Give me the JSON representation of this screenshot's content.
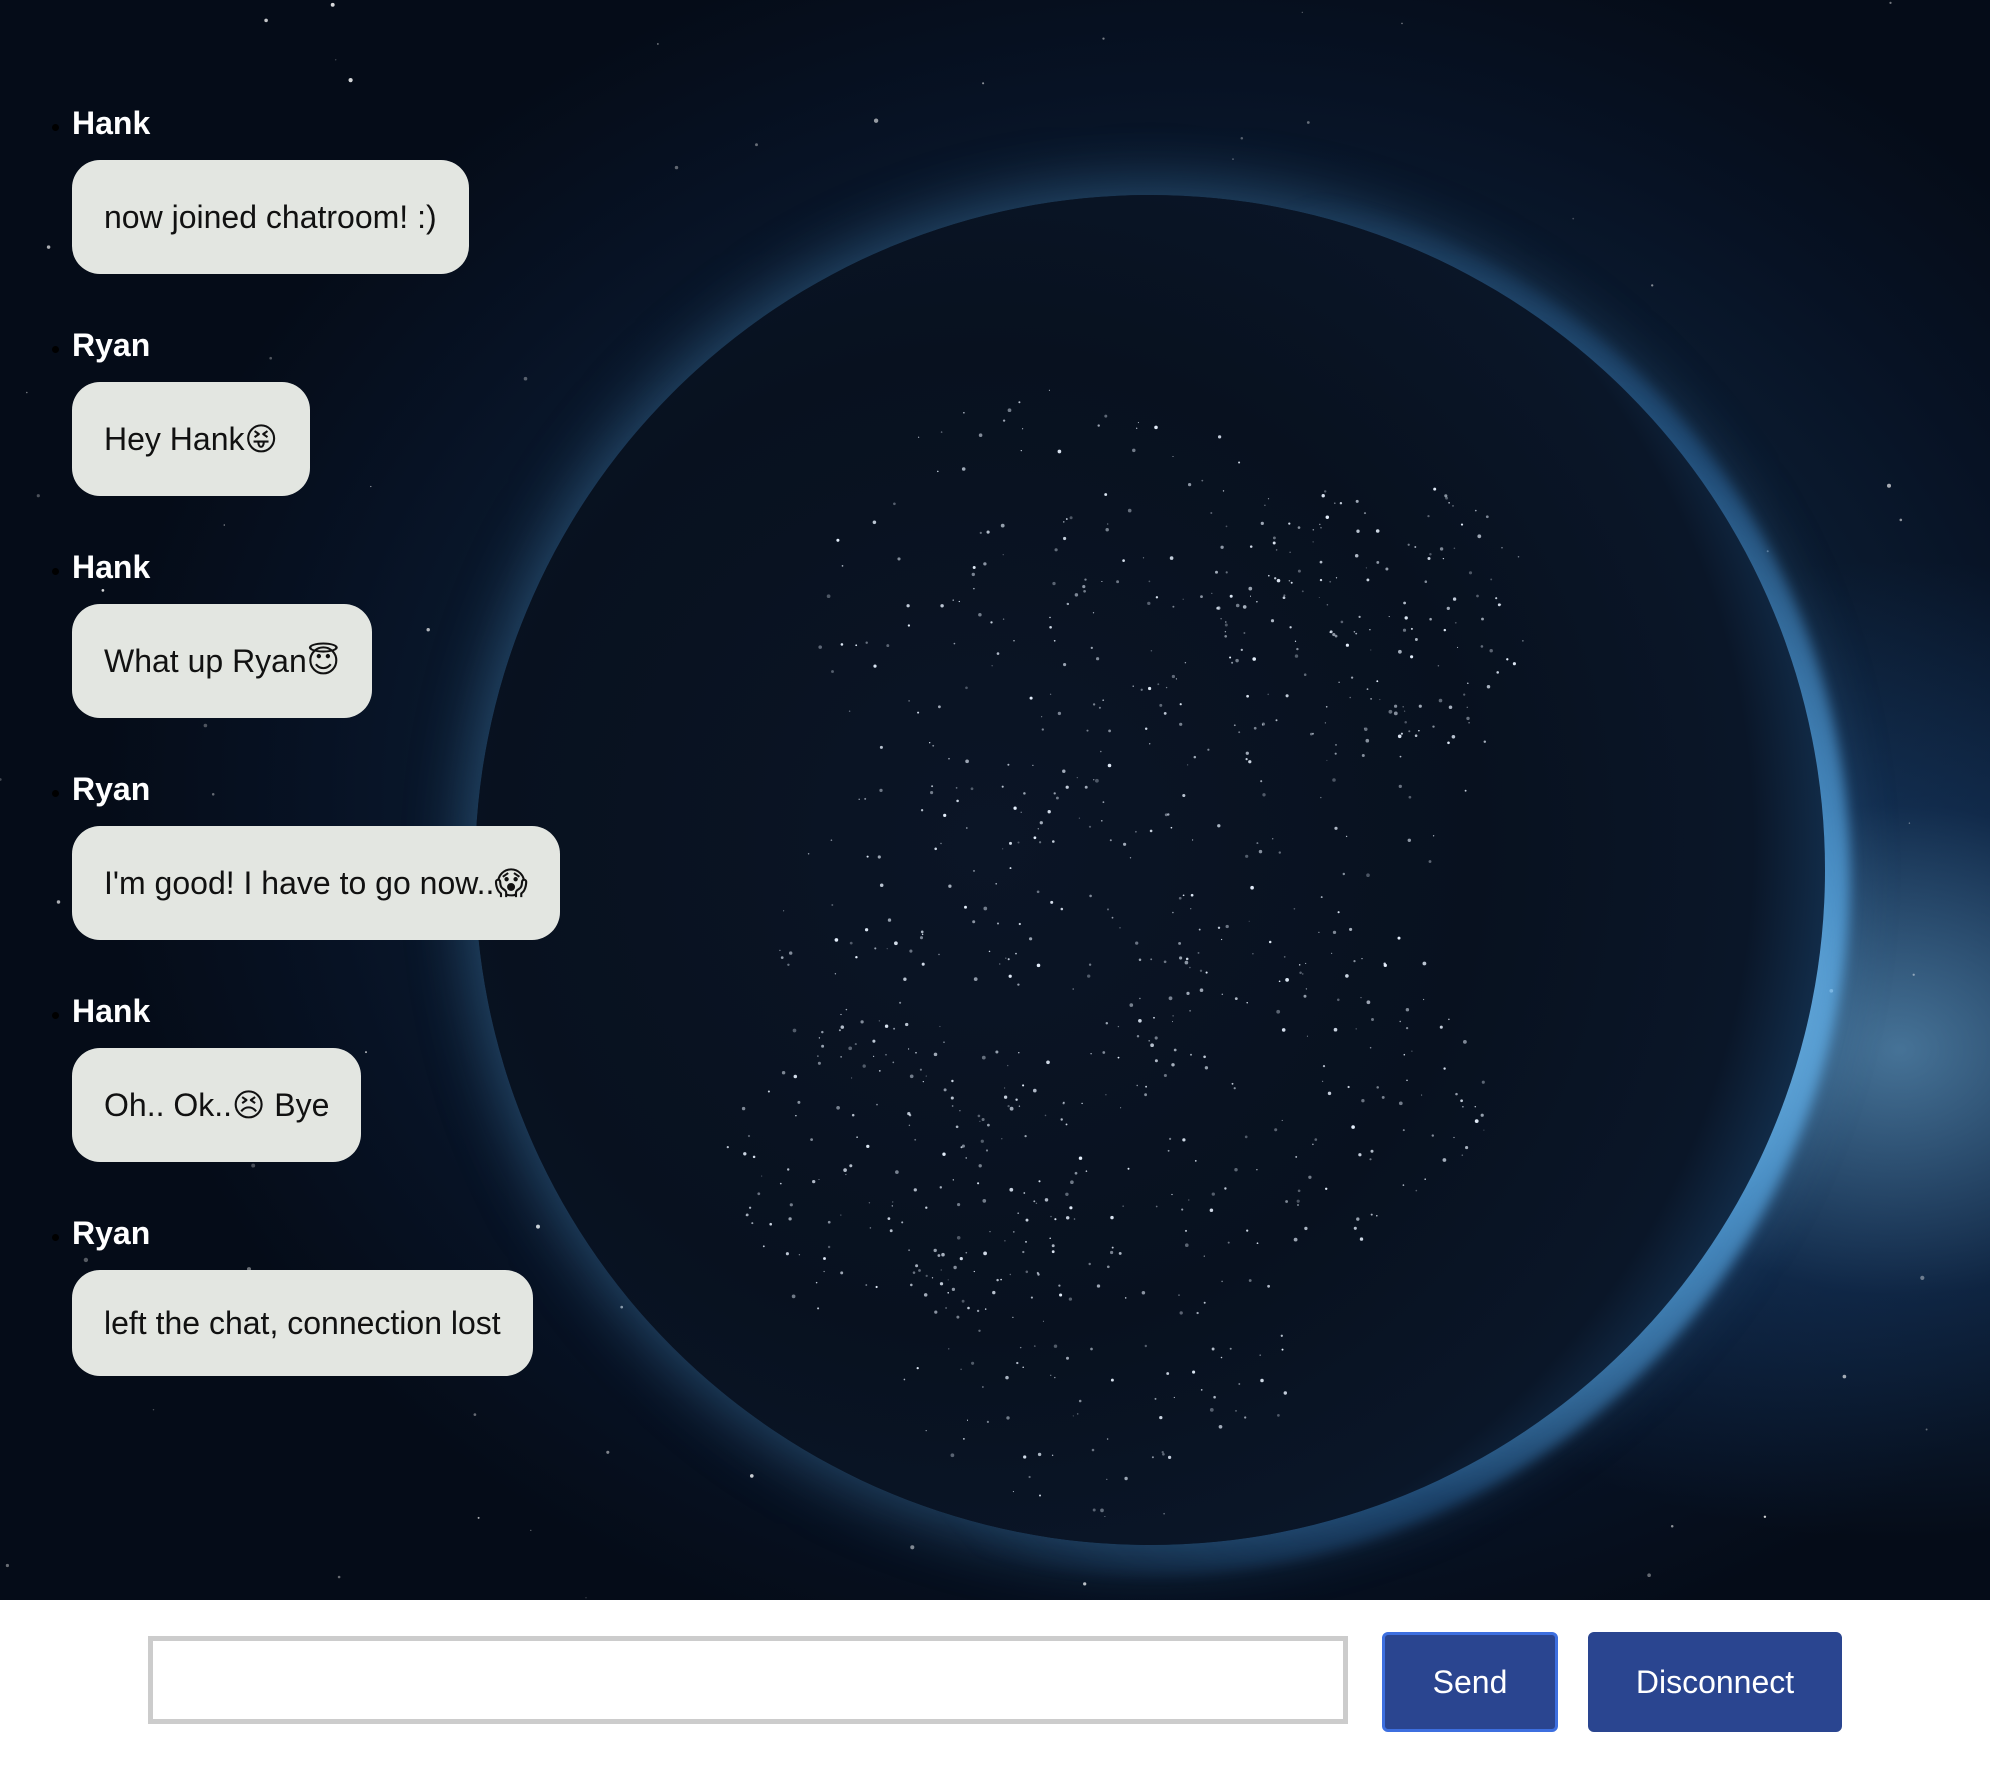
{
  "chat": {
    "messages": [
      {
        "sender": "Hank",
        "text": "now joined chatroom! :)"
      },
      {
        "sender": "Ryan",
        "text": "Hey Hank😝"
      },
      {
        "sender": "Hank",
        "text": "What up Ryan😇"
      },
      {
        "sender": "Ryan",
        "text": "I'm good! I have to go now..😱"
      },
      {
        "sender": "Hank",
        "text": "Oh.. Ok..😣 Bye"
      },
      {
        "sender": "Ryan",
        "text": "left the chat, connection lost"
      }
    ]
  },
  "composer": {
    "input_value": "",
    "input_placeholder": "",
    "send_label": "Send",
    "disconnect_label": "Disconnect"
  },
  "colors": {
    "bubble": "#e3e6e1",
    "button": "#2a4590",
    "send_border": "#3d6fe0",
    "input_border": "#cccccc"
  }
}
